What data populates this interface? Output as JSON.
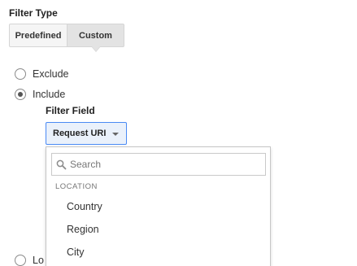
{
  "filter_type": {
    "label": "Filter Type",
    "tabs": [
      {
        "label": "Predefined",
        "selected": false
      },
      {
        "label": "Custom",
        "selected": true
      }
    ]
  },
  "mode": {
    "exclude_label": "Exclude",
    "include_label": "Include",
    "selected": "Include",
    "partial_label": "Lo"
  },
  "filter_field": {
    "label": "Filter Field",
    "value": "Request URI"
  },
  "dropdown": {
    "search_placeholder": "Search",
    "group_heading": "LOCATION",
    "options": [
      "Country",
      "Region",
      "City"
    ]
  },
  "colors": {
    "accent": "#4a8af4",
    "selected_tab": "#e3e3e3"
  }
}
